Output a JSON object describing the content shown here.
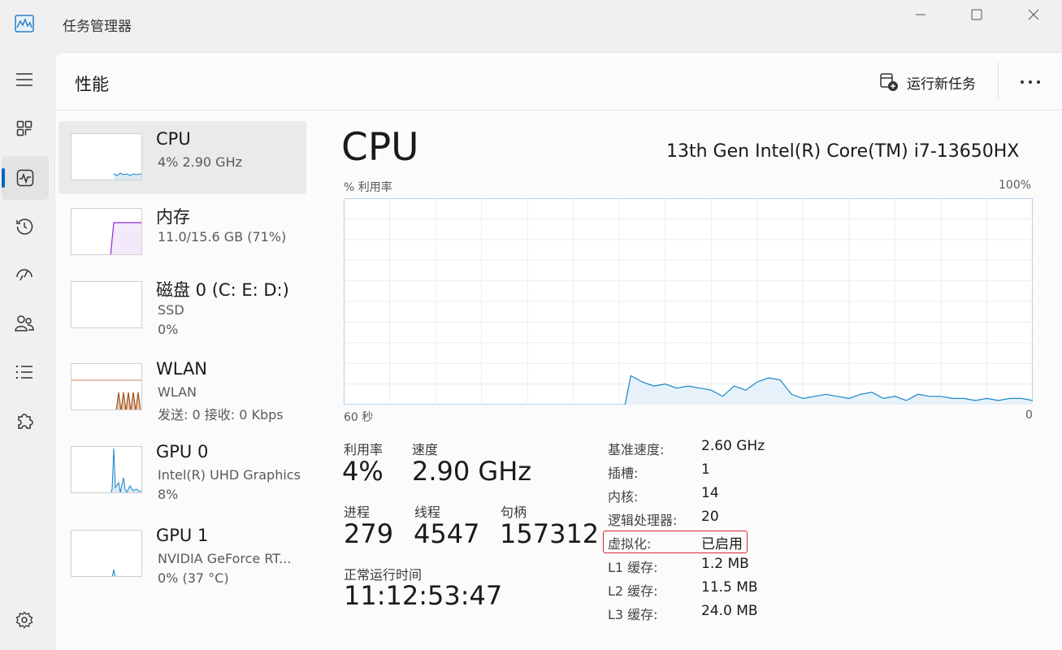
{
  "window": {
    "title": "任务管理器",
    "controls": [
      "minimize-icon",
      "maximize-icon",
      "close-icon"
    ]
  },
  "nav": {
    "items": [
      {
        "name": "hamburger-menu",
        "icon": "hamburger-icon"
      },
      {
        "name": "processes",
        "icon": "grid-icon"
      },
      {
        "name": "performance",
        "icon": "pulse-icon",
        "selected": true
      },
      {
        "name": "app-history",
        "icon": "history-icon"
      },
      {
        "name": "startup-apps",
        "icon": "speedometer-icon"
      },
      {
        "name": "users",
        "icon": "users-icon"
      },
      {
        "name": "details",
        "icon": "list-icon"
      },
      {
        "name": "services",
        "icon": "puzzle-icon"
      },
      {
        "name": "settings",
        "icon": "gear-icon"
      }
    ]
  },
  "header": {
    "title": "性能",
    "run_task_label": "运行新任务",
    "more_icon": "more-icon"
  },
  "devices": [
    {
      "name": "CPU",
      "lines": [
        "4%  2.90 GHz"
      ],
      "color": "#1a86c8"
    },
    {
      "name": "内存",
      "lines": [
        "11.0/15.6 GB (71%)"
      ],
      "color": "#8a2bd1"
    },
    {
      "name": "磁盘 0 (C: E: D:)",
      "lines": [
        "SSD",
        "0%"
      ],
      "color": "#4d9a2a"
    },
    {
      "name": "WLAN",
      "lines": [
        "WLAN",
        "发送: 0 接收: 0 Kbps"
      ],
      "color": "#a0521d"
    },
    {
      "name": "GPU 0",
      "lines": [
        "Intel(R) UHD Graphics",
        "8%"
      ],
      "color": "#1a86c8"
    },
    {
      "name": "GPU 1",
      "lines": [
        "NVIDIA GeForce RT...",
        "0%  (37 °C)"
      ],
      "color": "#1a86c8"
    }
  ],
  "detail": {
    "title": "CPU",
    "model": "13th Gen Intel(R) Core(TM) i7-13650HX",
    "graph": {
      "y_label": "% 利用率",
      "y_max_label": "100%",
      "x_label": "60 秒",
      "x_min_label": "0"
    },
    "stats": {
      "utilization_label": "利用率",
      "utilization_value": "4%",
      "speed_label": "速度",
      "speed_value": "2.90 GHz",
      "processes_label": "进程",
      "processes_value": "279",
      "threads_label": "线程",
      "threads_value": "4547",
      "handles_label": "句柄",
      "handles_value": "157312",
      "uptime_label": "正常运行时间",
      "uptime_value": "11:12:53:47"
    },
    "specs": [
      {
        "label": "基准速度:",
        "value": "2.60 GHz"
      },
      {
        "label": "插槽:",
        "value": "1"
      },
      {
        "label": "内核:",
        "value": "14"
      },
      {
        "label": "逻辑处理器:",
        "value": "20"
      },
      {
        "label": "虚拟化:",
        "value": "已启用",
        "highlighted": true
      },
      {
        "label": "L1 缓存:",
        "value": "1.2 MB"
      },
      {
        "label": "L2 缓存:",
        "value": "11.5 MB"
      },
      {
        "label": "L3 缓存:",
        "value": "24.0 MB"
      }
    ]
  },
  "chart_data": {
    "type": "area",
    "title": "",
    "x_unit": "秒",
    "xlim": [
      60,
      0
    ],
    "ylim": [
      0,
      100
    ],
    "grid": true,
    "series": [
      {
        "color": "#1a86c8",
        "x": [
          60,
          58,
          56,
          54,
          52,
          50,
          48,
          46,
          44,
          42,
          40,
          38,
          36,
          34,
          32,
          30,
          28,
          26,
          24,
          22,
          20,
          18,
          16,
          14,
          12,
          10,
          8,
          6,
          4,
          2,
          0
        ],
        "values": [
          0,
          0,
          0,
          0,
          0,
          0,
          0,
          0,
          0,
          0,
          0,
          0,
          0,
          0,
          0,
          0,
          0,
          0,
          0,
          15,
          10,
          9,
          8,
          7,
          5,
          6,
          4,
          6,
          5,
          4,
          3
        ]
      }
    ],
    "series_full": {
      "x": [
        60,
        57,
        54,
        51,
        48,
        45,
        42,
        39,
        36,
        35.5,
        35,
        34,
        33,
        32,
        31,
        30,
        29,
        28,
        27,
        26,
        25,
        24,
        23,
        22,
        21,
        20,
        19,
        18,
        17,
        16,
        15,
        14,
        13,
        12,
        11,
        10,
        9,
        8,
        7,
        6,
        5,
        4,
        3,
        2,
        1,
        0
      ],
      "values": [
        0,
        0,
        0,
        0,
        0,
        0,
        0,
        0,
        0,
        0,
        14,
        11,
        9,
        10,
        8,
        9,
        8,
        7,
        4,
        9,
        7,
        11,
        13,
        12,
        5,
        3,
        4,
        5,
        4,
        3,
        5,
        6,
        3,
        4,
        2,
        5,
        4,
        4,
        3,
        3,
        2,
        3,
        2,
        3,
        3,
        2
      ]
    }
  }
}
